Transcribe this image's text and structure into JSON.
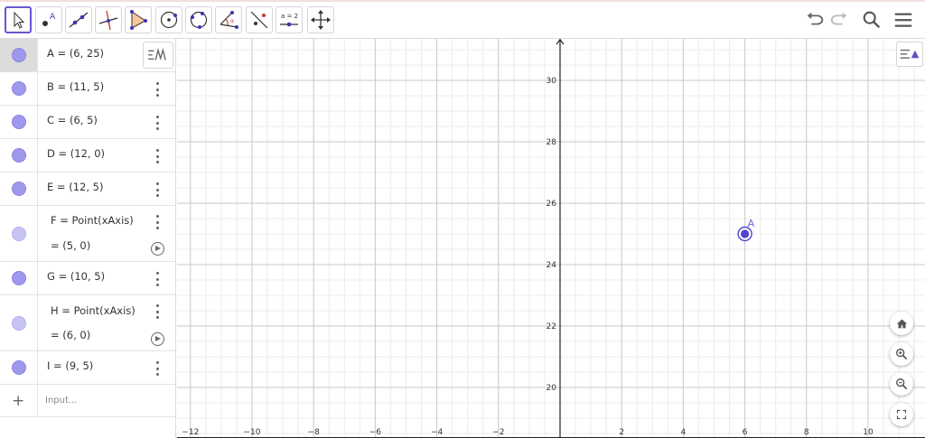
{
  "toolbar": {
    "tools": [
      {
        "name": "move-tool",
        "icon": "arrow-pointer-icon",
        "selected": true
      },
      {
        "name": "point-tool",
        "icon": "point-icon",
        "selected": false
      },
      {
        "name": "line-tool",
        "icon": "line-icon",
        "selected": false
      },
      {
        "name": "perpendicular-line-tool",
        "icon": "perpendicular-icon",
        "selected": false
      },
      {
        "name": "polygon-tool",
        "icon": "triangle-icon",
        "selected": false
      },
      {
        "name": "circle-center-point-tool",
        "icon": "circle-center-icon",
        "selected": false
      },
      {
        "name": "circle-three-points-tool",
        "icon": "circle-three-points-icon",
        "selected": false
      },
      {
        "name": "angle-tool",
        "icon": "angle-icon",
        "selected": false
      },
      {
        "name": "reflect-tool",
        "icon": "reflect-icon",
        "selected": false
      },
      {
        "name": "slider-tool",
        "icon": "slider-icon",
        "label": "a = 2",
        "selected": false
      },
      {
        "name": "move-graphics-tool",
        "icon": "move-arrows-icon",
        "selected": false
      }
    ],
    "right": [
      "undo-icon",
      "redo-icon",
      "search-icon",
      "menu-icon"
    ]
  },
  "algebra": {
    "rows": [
      {
        "label": "A = (6, 25)",
        "active": true
      },
      {
        "label": "B = (11, 5)"
      },
      {
        "label": "C = (6, 5)"
      },
      {
        "label": "D = (12, 0)"
      },
      {
        "label": "E = (12, 5)"
      },
      {
        "label": "F = Point(xAxis)",
        "value": "= (5, 0)",
        "slider": true
      },
      {
        "label": "G = (10, 5)"
      },
      {
        "label": "H = Point(xAxis)",
        "value": "= (6, 0)",
        "slider": true
      },
      {
        "label": "I = (9, 5)"
      }
    ],
    "input_placeholder": "Input..."
  },
  "graphics": {
    "x_ticks": [
      "−12",
      "−10",
      "−8",
      "−6",
      "−4",
      "−2",
      "2",
      "4",
      "6",
      "8",
      "10"
    ],
    "y_ticks": [
      "20",
      "22",
      "24",
      "26",
      "28",
      "30"
    ],
    "point": {
      "label": "A",
      "x": 6,
      "y": 25
    },
    "controls": [
      "home-icon",
      "zoom-in-icon",
      "zoom-out-icon",
      "fullscreen-icon"
    ]
  },
  "colors": {
    "accent": "#6557d2",
    "point": "#4f45c8",
    "grid_major": "#c8c8c8",
    "grid_minor": "#ececec"
  }
}
